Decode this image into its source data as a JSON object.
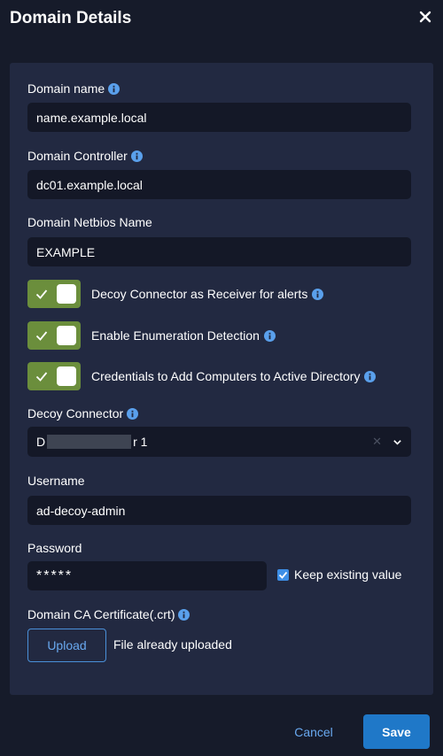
{
  "dialog": {
    "title": "Domain Details"
  },
  "fields": {
    "domain_name": {
      "label": "Domain name",
      "value": "name.example.local"
    },
    "domain_controller": {
      "label": "Domain Controller",
      "value": "dc01.example.local"
    },
    "netbios": {
      "label": "Domain Netbios Name",
      "value": "EXAMPLE"
    },
    "decoy_connector": {
      "label": "Decoy Connector",
      "value_prefix": "D",
      "value_suffix": "r 1"
    },
    "username": {
      "label": "Username",
      "value": "ad-decoy-admin"
    },
    "password": {
      "label": "Password",
      "value": "*****",
      "keep_existing_label": "Keep existing value",
      "keep_existing_checked": true
    },
    "ca_certificate": {
      "label": "Domain CA Certificate(.crt)",
      "upload_label": "Upload",
      "status": "File already uploaded"
    }
  },
  "toggles": [
    {
      "label": "Decoy Connector as Receiver for alerts",
      "enabled": true
    },
    {
      "label": "Enable Enumeration Detection",
      "enabled": true
    },
    {
      "label": "Credentials to Add Computers to Active Directory",
      "enabled": true
    }
  ],
  "actions": {
    "cancel_label": "Cancel",
    "save_label": "Save"
  },
  "colors": {
    "background": "#161b2a",
    "panel": "#222941",
    "input": "#141827",
    "toggle_on": "#6b8e3c",
    "accent": "#1f78c8",
    "link": "#69a9f0",
    "info_icon": "#5aa0ec"
  }
}
